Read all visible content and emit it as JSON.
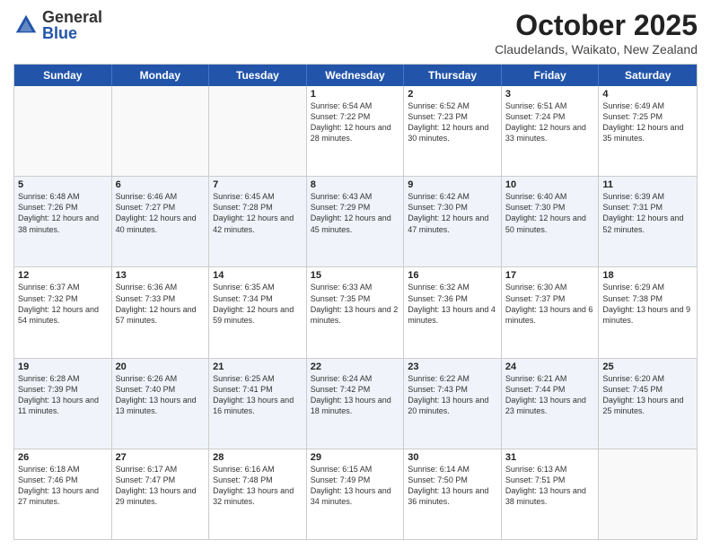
{
  "header": {
    "logo_general": "General",
    "logo_blue": "Blue",
    "month_title": "October 2025",
    "location": "Claudelands, Waikato, New Zealand"
  },
  "weekdays": [
    "Sunday",
    "Monday",
    "Tuesday",
    "Wednesday",
    "Thursday",
    "Friday",
    "Saturday"
  ],
  "rows": [
    [
      {
        "day": "",
        "info": ""
      },
      {
        "day": "",
        "info": ""
      },
      {
        "day": "",
        "info": ""
      },
      {
        "day": "1",
        "info": "Sunrise: 6:54 AM\nSunset: 7:22 PM\nDaylight: 12 hours\nand 28 minutes."
      },
      {
        "day": "2",
        "info": "Sunrise: 6:52 AM\nSunset: 7:23 PM\nDaylight: 12 hours\nand 30 minutes."
      },
      {
        "day": "3",
        "info": "Sunrise: 6:51 AM\nSunset: 7:24 PM\nDaylight: 12 hours\nand 33 minutes."
      },
      {
        "day": "4",
        "info": "Sunrise: 6:49 AM\nSunset: 7:25 PM\nDaylight: 12 hours\nand 35 minutes."
      }
    ],
    [
      {
        "day": "5",
        "info": "Sunrise: 6:48 AM\nSunset: 7:26 PM\nDaylight: 12 hours\nand 38 minutes."
      },
      {
        "day": "6",
        "info": "Sunrise: 6:46 AM\nSunset: 7:27 PM\nDaylight: 12 hours\nand 40 minutes."
      },
      {
        "day": "7",
        "info": "Sunrise: 6:45 AM\nSunset: 7:28 PM\nDaylight: 12 hours\nand 42 minutes."
      },
      {
        "day": "8",
        "info": "Sunrise: 6:43 AM\nSunset: 7:29 PM\nDaylight: 12 hours\nand 45 minutes."
      },
      {
        "day": "9",
        "info": "Sunrise: 6:42 AM\nSunset: 7:30 PM\nDaylight: 12 hours\nand 47 minutes."
      },
      {
        "day": "10",
        "info": "Sunrise: 6:40 AM\nSunset: 7:30 PM\nDaylight: 12 hours\nand 50 minutes."
      },
      {
        "day": "11",
        "info": "Sunrise: 6:39 AM\nSunset: 7:31 PM\nDaylight: 12 hours\nand 52 minutes."
      }
    ],
    [
      {
        "day": "12",
        "info": "Sunrise: 6:37 AM\nSunset: 7:32 PM\nDaylight: 12 hours\nand 54 minutes."
      },
      {
        "day": "13",
        "info": "Sunrise: 6:36 AM\nSunset: 7:33 PM\nDaylight: 12 hours\nand 57 minutes."
      },
      {
        "day": "14",
        "info": "Sunrise: 6:35 AM\nSunset: 7:34 PM\nDaylight: 12 hours\nand 59 minutes."
      },
      {
        "day": "15",
        "info": "Sunrise: 6:33 AM\nSunset: 7:35 PM\nDaylight: 13 hours\nand 2 minutes."
      },
      {
        "day": "16",
        "info": "Sunrise: 6:32 AM\nSunset: 7:36 PM\nDaylight: 13 hours\nand 4 minutes."
      },
      {
        "day": "17",
        "info": "Sunrise: 6:30 AM\nSunset: 7:37 PM\nDaylight: 13 hours\nand 6 minutes."
      },
      {
        "day": "18",
        "info": "Sunrise: 6:29 AM\nSunset: 7:38 PM\nDaylight: 13 hours\nand 9 minutes."
      }
    ],
    [
      {
        "day": "19",
        "info": "Sunrise: 6:28 AM\nSunset: 7:39 PM\nDaylight: 13 hours\nand 11 minutes."
      },
      {
        "day": "20",
        "info": "Sunrise: 6:26 AM\nSunset: 7:40 PM\nDaylight: 13 hours\nand 13 minutes."
      },
      {
        "day": "21",
        "info": "Sunrise: 6:25 AM\nSunset: 7:41 PM\nDaylight: 13 hours\nand 16 minutes."
      },
      {
        "day": "22",
        "info": "Sunrise: 6:24 AM\nSunset: 7:42 PM\nDaylight: 13 hours\nand 18 minutes."
      },
      {
        "day": "23",
        "info": "Sunrise: 6:22 AM\nSunset: 7:43 PM\nDaylight: 13 hours\nand 20 minutes."
      },
      {
        "day": "24",
        "info": "Sunrise: 6:21 AM\nSunset: 7:44 PM\nDaylight: 13 hours\nand 23 minutes."
      },
      {
        "day": "25",
        "info": "Sunrise: 6:20 AM\nSunset: 7:45 PM\nDaylight: 13 hours\nand 25 minutes."
      }
    ],
    [
      {
        "day": "26",
        "info": "Sunrise: 6:18 AM\nSunset: 7:46 PM\nDaylight: 13 hours\nand 27 minutes."
      },
      {
        "day": "27",
        "info": "Sunrise: 6:17 AM\nSunset: 7:47 PM\nDaylight: 13 hours\nand 29 minutes."
      },
      {
        "day": "28",
        "info": "Sunrise: 6:16 AM\nSunset: 7:48 PM\nDaylight: 13 hours\nand 32 minutes."
      },
      {
        "day": "29",
        "info": "Sunrise: 6:15 AM\nSunset: 7:49 PM\nDaylight: 13 hours\nand 34 minutes."
      },
      {
        "day": "30",
        "info": "Sunrise: 6:14 AM\nSunset: 7:50 PM\nDaylight: 13 hours\nand 36 minutes."
      },
      {
        "day": "31",
        "info": "Sunrise: 6:13 AM\nSunset: 7:51 PM\nDaylight: 13 hours\nand 38 minutes."
      },
      {
        "day": "",
        "info": ""
      }
    ]
  ],
  "alt_rows": [
    1,
    3
  ]
}
